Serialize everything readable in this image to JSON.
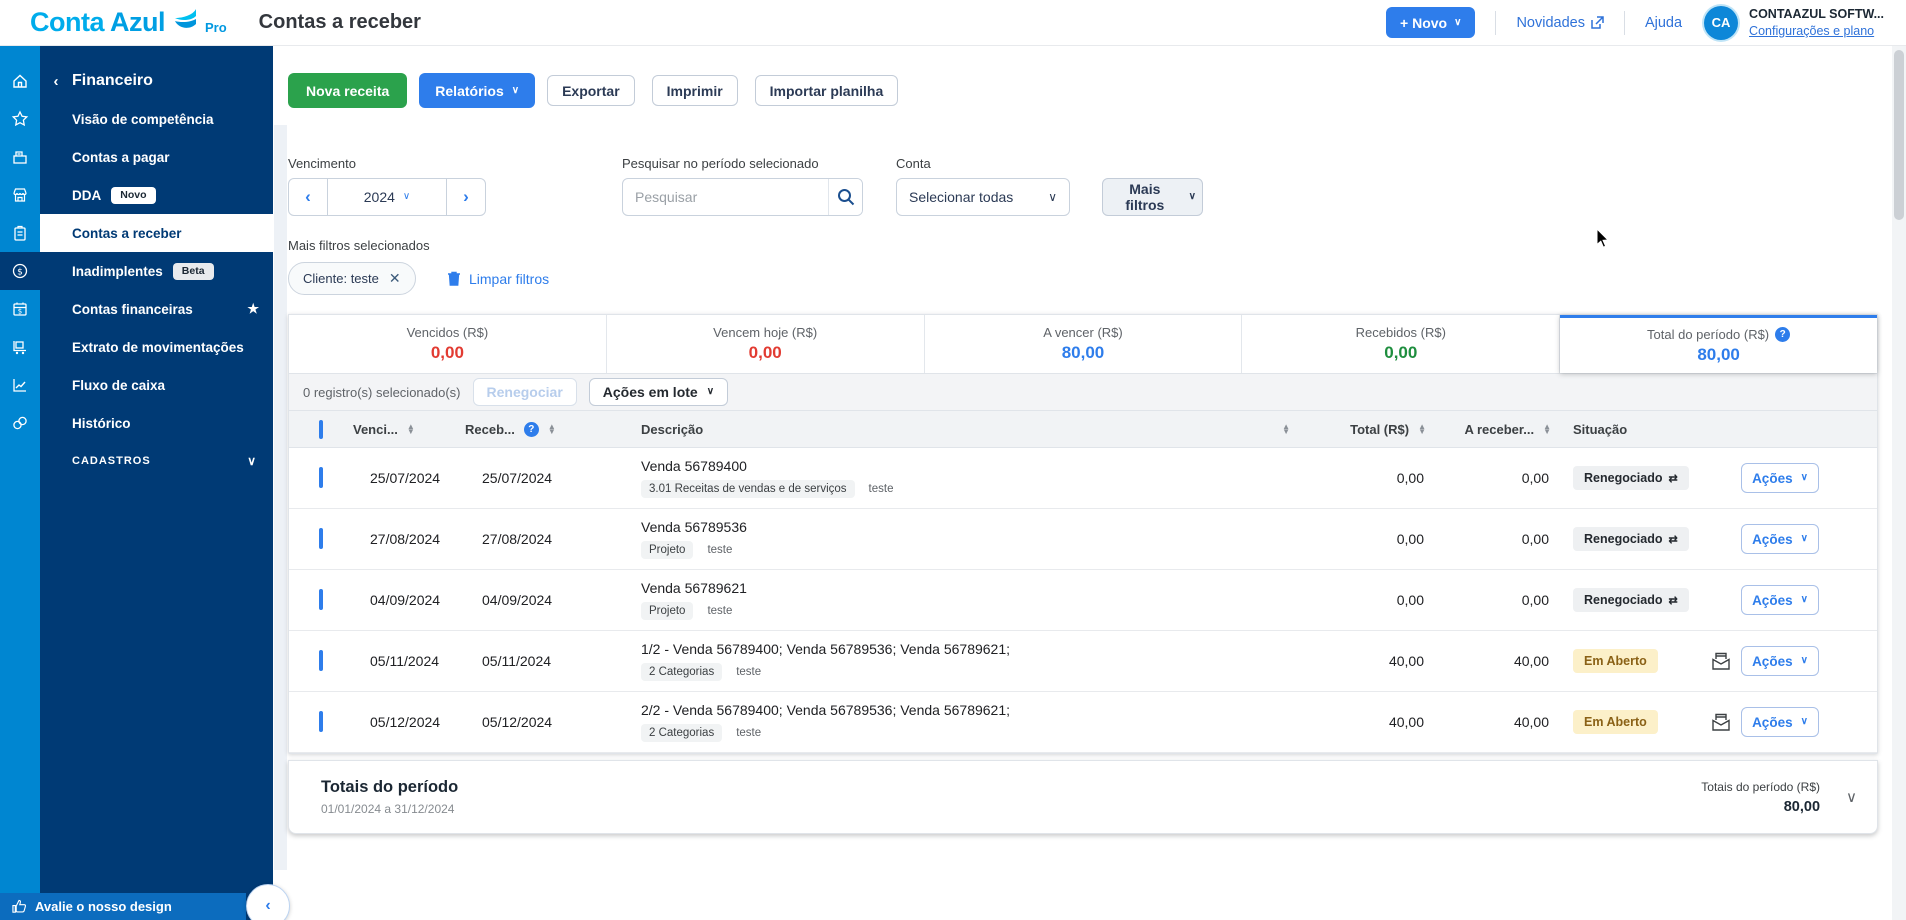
{
  "header": {
    "logo_part1": "Conta",
    "logo_part2": "Azul",
    "logo_badge": "Pro",
    "page_title": "Contas a receber",
    "novo_button": "+ Novo",
    "novidades_link": "Novidades",
    "ajuda_link": "Ajuda",
    "account_initials": "CA",
    "account_name": "CONTAAZUL SOFTW...",
    "account_settings": "Configurações e plano"
  },
  "sidebar": {
    "section_title": "Financeiro",
    "rail_icons": [
      "home",
      "star",
      "cash-register",
      "store",
      "clipboard",
      "dollar-circle",
      "calendar-dollar",
      "delivery",
      "chart",
      "link"
    ],
    "rail_active_index": 5,
    "items": [
      {
        "label": "Visão de competência",
        "badge": "",
        "badge_style": "",
        "active": false,
        "star": false
      },
      {
        "label": "Contas a pagar",
        "badge": "",
        "badge_style": "",
        "active": false,
        "star": false
      },
      {
        "label": "DDA",
        "badge": "Novo",
        "badge_style": "white",
        "active": false,
        "star": false
      },
      {
        "label": "Contas a receber",
        "badge": "",
        "badge_style": "",
        "active": true,
        "star": false
      },
      {
        "label": "Inadimplentes",
        "badge": "Beta",
        "badge_style": "gray",
        "active": false,
        "star": false
      },
      {
        "label": "Contas financeiras",
        "badge": "",
        "badge_style": "",
        "active": false,
        "star": true
      },
      {
        "label": "Extrato de movimentações",
        "badge": "",
        "badge_style": "",
        "active": false,
        "star": false
      },
      {
        "label": "Fluxo de caixa",
        "badge": "",
        "badge_style": "",
        "active": false,
        "star": false
      },
      {
        "label": "Histórico",
        "badge": "",
        "badge_style": "",
        "active": false,
        "star": false
      }
    ],
    "cadastros_label": "CADASTROS",
    "rate_design": "Avalie o nosso design"
  },
  "toolbar": {
    "nova_receita": "Nova receita",
    "relatorios": "Relatórios",
    "exportar": "Exportar",
    "imprimir": "Imprimir",
    "importar_planilha": "Importar planilha"
  },
  "filters": {
    "vencimento_label": "Vencimento",
    "year_value": "2024",
    "search_label": "Pesquisar no período selecionado",
    "search_placeholder": "Pesquisar",
    "conta_label": "Conta",
    "conta_value": "Selecionar todas",
    "mais_filtros": "Mais filtros",
    "selected_filters_label": "Mais filtros selecionados",
    "chip_label": "Cliente: teste",
    "limpar_filtros": "Limpar filtros"
  },
  "summary_cards": [
    {
      "label": "Vencidos (R$)",
      "value": "0,00",
      "color": "#e23b32",
      "help": false,
      "selected": false
    },
    {
      "label": "Vencem hoje (R$)",
      "value": "0,00",
      "color": "#e23b32",
      "help": false,
      "selected": false
    },
    {
      "label": "A vencer (R$)",
      "value": "80,00",
      "color": "#2e7deb",
      "help": false,
      "selected": false
    },
    {
      "label": "Recebidos (R$)",
      "value": "0,00",
      "color": "#1e8e3e",
      "help": false,
      "selected": false
    },
    {
      "label": "Total do período (R$)",
      "value": "80,00",
      "color": "#2e7deb",
      "help": true,
      "selected": true
    }
  ],
  "bulk_bar": {
    "selected_text": "0 registro(s) selecionado(s)",
    "renegociar": "Renegociar",
    "acoes_em_lote": "Ações em lote"
  },
  "table": {
    "headers": {
      "vencimento": "Venci...",
      "recebido": "Receb...",
      "descricao": "Descrição",
      "total": "Total (R$)",
      "a_receber": "A receber...",
      "situacao": "Situação"
    },
    "acoes_label": "Ações",
    "rows": [
      {
        "vencimento": "25/07/2024",
        "recebido": "25/07/2024",
        "titulo": "Venda 56789400",
        "tag": "3.01 Receitas de vendas e de serviços",
        "cliente": "teste",
        "total": "0,00",
        "a_receber": "0,00",
        "situacao": "Renegociado",
        "situacao_tipo": "renegociado",
        "envelope": false
      },
      {
        "vencimento": "27/08/2024",
        "recebido": "27/08/2024",
        "titulo": "Venda 56789536",
        "tag": "Projeto",
        "cliente": "teste",
        "total": "0,00",
        "a_receber": "0,00",
        "situacao": "Renegociado",
        "situacao_tipo": "renegociado",
        "envelope": false
      },
      {
        "vencimento": "04/09/2024",
        "recebido": "04/09/2024",
        "titulo": "Venda 56789621",
        "tag": "Projeto",
        "cliente": "teste",
        "total": "0,00",
        "a_receber": "0,00",
        "situacao": "Renegociado",
        "situacao_tipo": "renegociado",
        "envelope": false
      },
      {
        "vencimento": "05/11/2024",
        "recebido": "05/11/2024",
        "titulo": "1/2 - Venda 56789400; Venda 56789536; Venda 56789621;",
        "tag": "2 Categorias",
        "cliente": "teste",
        "total": "40,00",
        "a_receber": "40,00",
        "situacao": "Em Aberto",
        "situacao_tipo": "aberto",
        "envelope": true
      },
      {
        "vencimento": "05/12/2024",
        "recebido": "05/12/2024",
        "titulo": "2/2 - Venda 56789400; Venda 56789536; Venda 56789621;",
        "tag": "2 Categorias",
        "cliente": "teste",
        "total": "40,00",
        "a_receber": "40,00",
        "situacao": "Em Aberto",
        "situacao_tipo": "aberto",
        "envelope": true
      }
    ]
  },
  "totals_footer": {
    "title": "Totais do período",
    "period": "01/01/2024 a 31/12/2024",
    "right_label": "Totais do período (R$)",
    "right_value": "80,00"
  },
  "colors": {
    "rail_blue": "#0086d1",
    "panel_navy": "#003a75",
    "accent_blue": "#2e7deb",
    "green": "#2ba24c",
    "red_value": "#e23b32",
    "green_value": "#1e8e3e"
  }
}
